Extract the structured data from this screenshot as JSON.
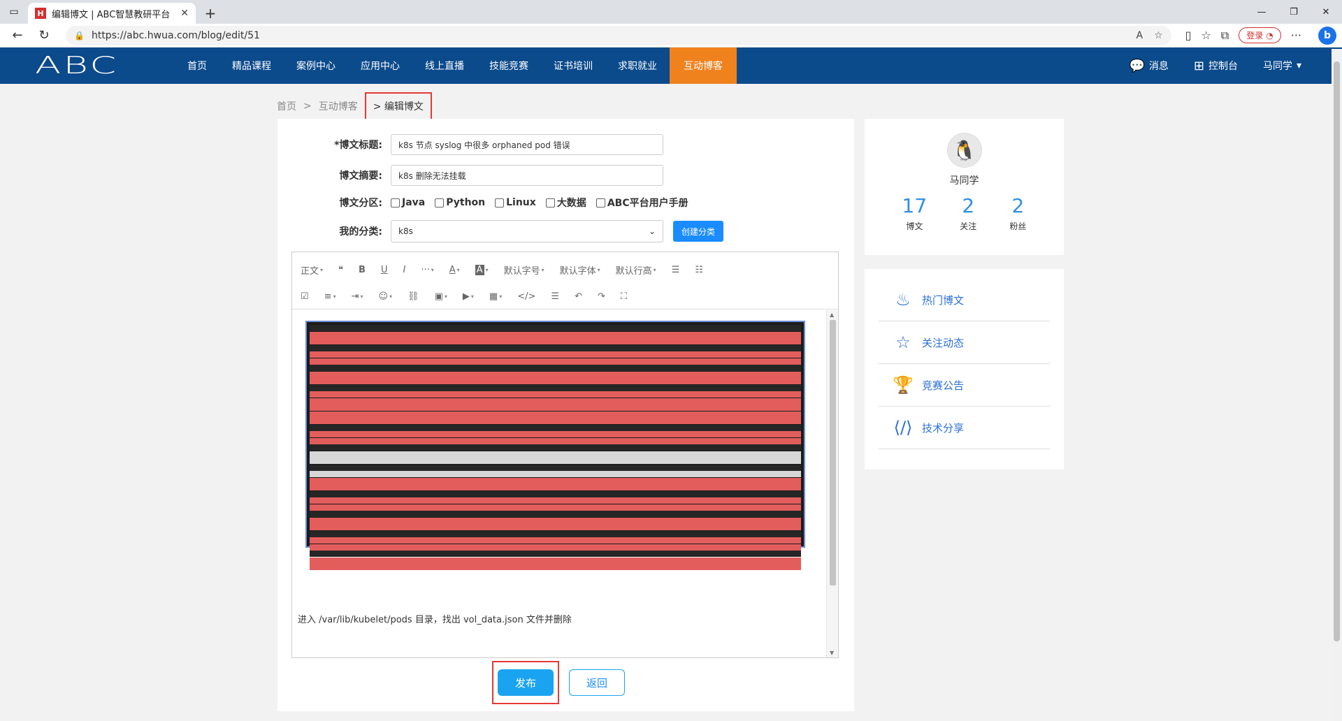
{
  "browser": {
    "tab_title": "编辑博文 | ABC智慧教研平台",
    "favicon_letter": "H",
    "url": "https://abc.hwua.com/blog/edit/51",
    "login_label": "登录"
  },
  "site": {
    "logo": "ABC",
    "nav": [
      "首页",
      "精品课程",
      "案例中心",
      "应用中心",
      "线上直播",
      "技能竞赛",
      "证书培训",
      "求职就业",
      "互动博客"
    ],
    "active_nav": "互动博客",
    "right": {
      "messages": "消息",
      "console": "控制台",
      "user": "马同学"
    },
    "accent_color": "#f0821e",
    "nav_color": "#0b4a8b"
  },
  "breadcrumb": {
    "home": "首页",
    "section": "互动博客",
    "current": "编辑博文",
    "sep": ">"
  },
  "form": {
    "title_label": "*博文标题:",
    "title_value": "k8s 节点 syslog 中很多 orphaned pod 错误",
    "summary_label": "博文摘要:",
    "summary_value": "k8s 删除无法挂载",
    "zone_label": "博文分区:",
    "zones": [
      "Java",
      "Python",
      "Linux",
      "大数据",
      "ABC平台用户手册"
    ],
    "category_label": "我的分类:",
    "category_value": "k8s",
    "create_category": "创建分类"
  },
  "toolbar": {
    "row1": [
      "正文",
      "❝",
      "B",
      "U",
      "I",
      "···",
      "A",
      "A",
      "默认字号",
      "默认字体",
      "默认行高",
      "☰",
      "☷"
    ],
    "row2": [
      "☑",
      "≡",
      "⇥",
      "☺",
      "⛓",
      "▣",
      "▶",
      "▦",
      "</>",
      "☰",
      "↶",
      "↷",
      "⛶"
    ]
  },
  "editor": {
    "body_text": "进入 /var/lib/kubelet/pods 目录，找出 vol_data.json 文件并删除"
  },
  "actions": {
    "publish": "发布",
    "back": "返回"
  },
  "profile": {
    "name": "马同学",
    "stats": [
      {
        "num": "17",
        "label": "博文"
      },
      {
        "num": "2",
        "label": "关注"
      },
      {
        "num": "2",
        "label": "粉丝"
      }
    ]
  },
  "sidebar_links": [
    {
      "label": "热门博文",
      "icon": "fire-icon"
    },
    {
      "label": "关注动态",
      "icon": "star-icon"
    },
    {
      "label": "竞赛公告",
      "icon": "trophy-icon"
    },
    {
      "label": "技术分享",
      "icon": "code-file-icon"
    }
  ]
}
